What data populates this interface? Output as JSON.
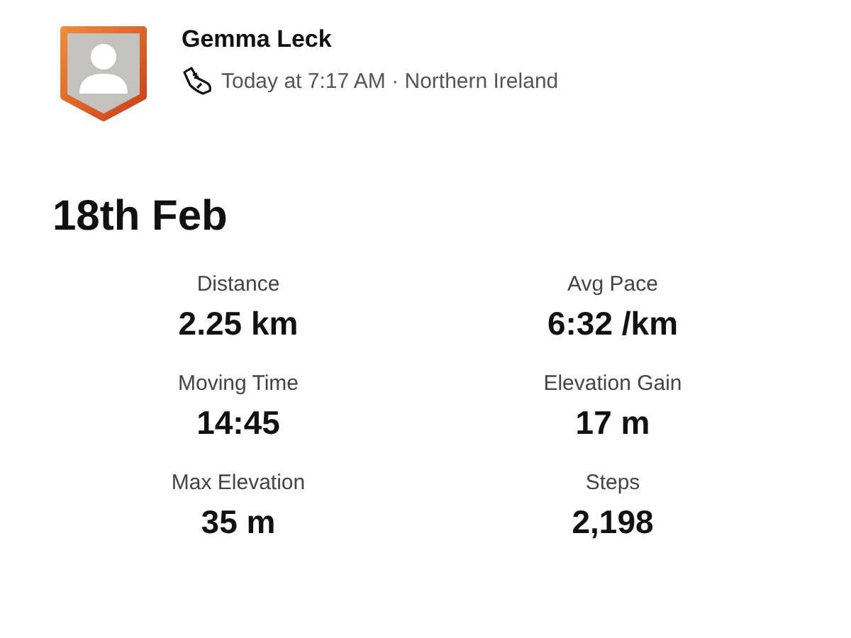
{
  "athlete": {
    "name": "Gemma Leck",
    "meta": "Today at 7:17 AM · Northern Ireland"
  },
  "title": "18th Feb",
  "stats": [
    {
      "label": "Distance",
      "value": "2.25 km"
    },
    {
      "label": "Avg Pace",
      "value": "6:32 /km"
    },
    {
      "label": "Moving Time",
      "value": "14:45"
    },
    {
      "label": "Elevation Gain",
      "value": "17 m"
    },
    {
      "label": "Max Elevation",
      "value": "35 m"
    },
    {
      "label": "Steps",
      "value": "2,198"
    }
  ]
}
